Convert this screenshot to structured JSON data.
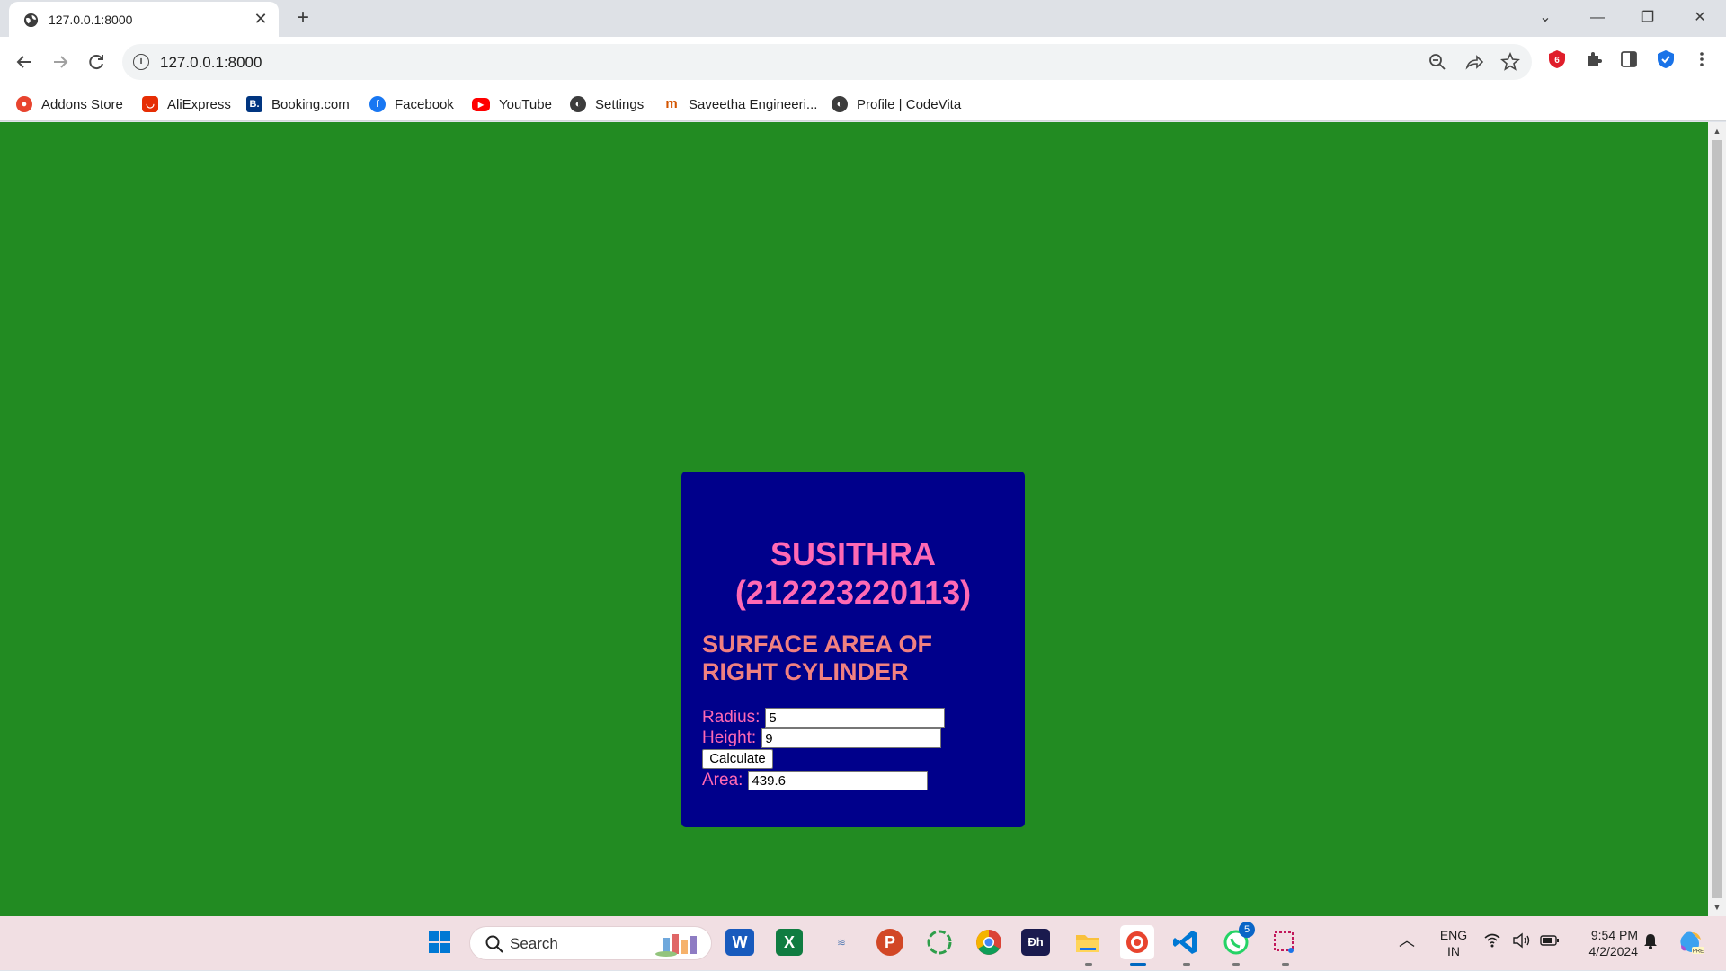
{
  "browser": {
    "tab": {
      "title": "127.0.0.1:8000",
      "close": "✕"
    },
    "new_tab": "+",
    "window": {
      "dropdown": "⌄",
      "minimize": "—",
      "restore": "❐",
      "close": "✕"
    },
    "address": {
      "url": "127.0.0.1:8000",
      "info": "i"
    },
    "bookmarks": [
      {
        "label": "Addons Store",
        "icon": "addons-store-icon",
        "color": "#e8442e"
      },
      {
        "label": "AliExpress",
        "icon": "aliexpress-icon",
        "color": "#e62e04"
      },
      {
        "label": "Booking.com",
        "icon": "booking-icon",
        "color": "#003580"
      },
      {
        "label": "Facebook",
        "icon": "facebook-icon",
        "color": "#1877f2"
      },
      {
        "label": "YouTube",
        "icon": "youtube-icon",
        "color": "#ff0000"
      },
      {
        "label": "Settings",
        "icon": "globe-icon",
        "color": "#3c3c3c"
      },
      {
        "label": "Saveetha Engineeri...",
        "icon": "saveetha-icon",
        "color": "#f39c12"
      },
      {
        "label": "Profile | CodeVita",
        "icon": "globe-icon",
        "color": "#3c3c3c"
      }
    ]
  },
  "page": {
    "background": "#228b22",
    "card_color": "#00008b",
    "name_line1": "SUSITHRA",
    "name_line2": "(212223220113)",
    "heading_line1": "SURFACE AREA OF",
    "heading_line2": "RIGHT CYLINDER",
    "radius_label": "Radius:",
    "radius_value": "5",
    "height_label": "Height:",
    "height_value": "9",
    "calculate_label": "Calculate",
    "area_label": "Area:",
    "area_value": "439.6"
  },
  "taskbar": {
    "search_label": "Search",
    "whatsapp_badge": "5",
    "lang_line1": "ENG",
    "lang_line2": "IN",
    "time": "9:54 PM",
    "date": "4/2/2024"
  }
}
